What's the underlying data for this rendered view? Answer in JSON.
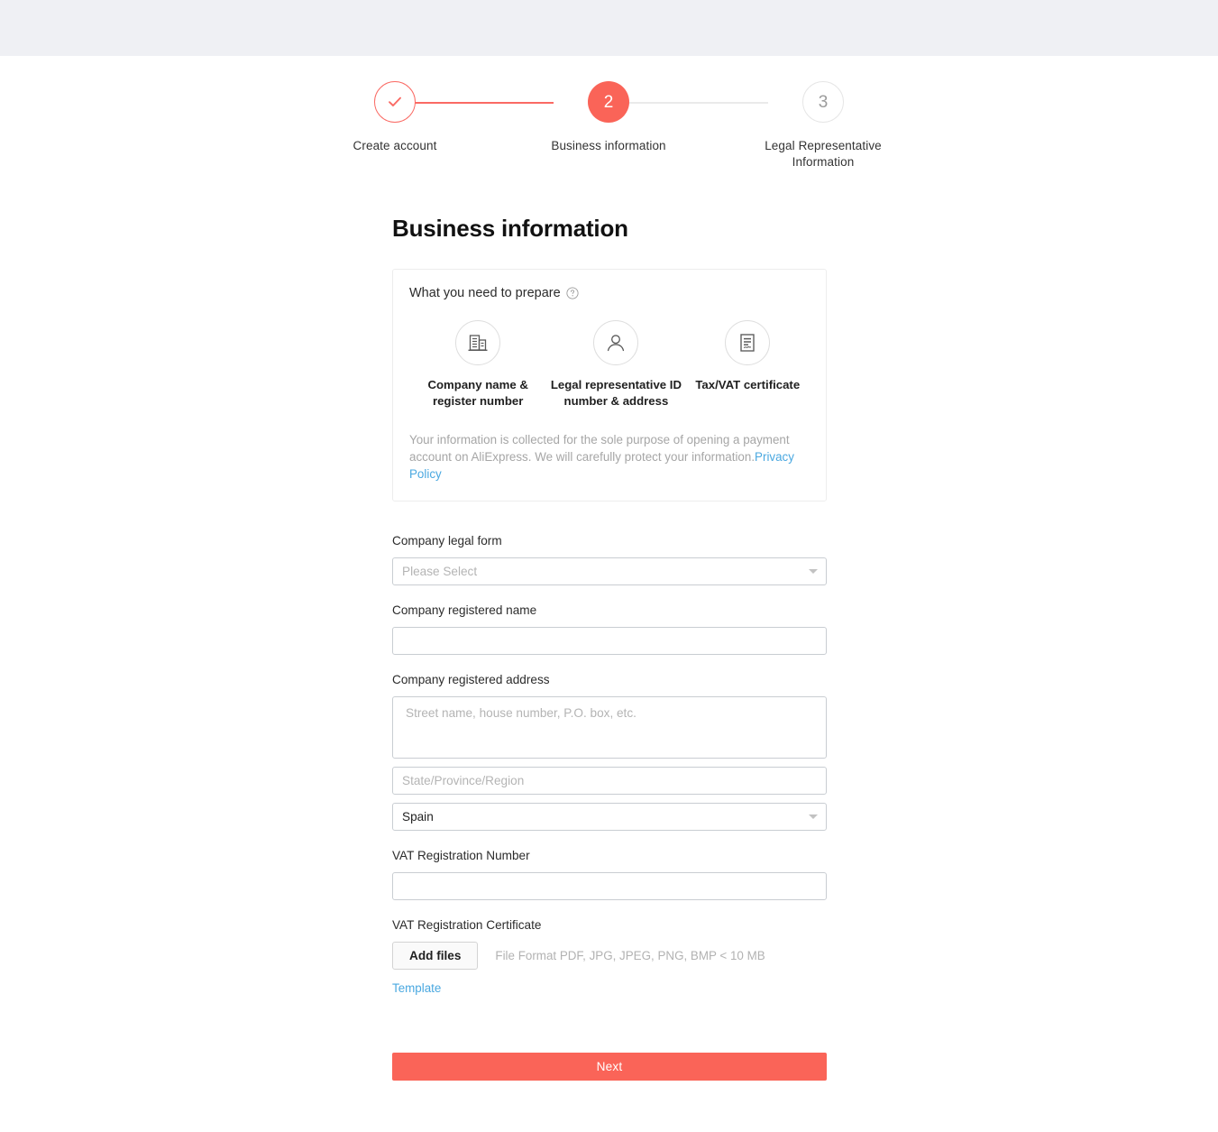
{
  "stepper": {
    "steps": [
      {
        "marker": "check-icon",
        "number": "",
        "label": "Create account",
        "state": "done"
      },
      {
        "marker": "2",
        "number": "2",
        "label": "Business information",
        "state": "active"
      },
      {
        "marker": "3",
        "number": "3",
        "label": "Legal Representative Information",
        "state": "todo"
      }
    ]
  },
  "main": {
    "title": "Business information"
  },
  "prepare": {
    "heading": "What you need to prepare",
    "help_icon": "question-circle-icon",
    "items": [
      {
        "icon": "building-icon",
        "label": "Company name & register number"
      },
      {
        "icon": "person-icon",
        "label": "Legal representative ID number & address"
      },
      {
        "icon": "document-icon",
        "label": "Tax/VAT certificate"
      }
    ],
    "privacy_text": "Your information is collected for the sole purpose of opening a payment account on AliExpress. We will carefully protect your information.",
    "privacy_link": "Privacy Policy"
  },
  "form": {
    "legal_form": {
      "label": "Company legal form",
      "value": "",
      "placeholder": "Please Select"
    },
    "registered_name": {
      "label": "Company registered name",
      "value": "",
      "placeholder": ""
    },
    "registered_address": {
      "label": "Company registered address",
      "street_placeholder": "Street name, house number, P.O. box, etc.",
      "street_value": "",
      "state_placeholder": "State/Province/Region",
      "state_value": "",
      "country_value": "Spain"
    },
    "vat_number": {
      "label": "VAT Registration Number",
      "value": "",
      "placeholder": ""
    },
    "vat_certificate": {
      "label": "VAT Registration Certificate",
      "add_files_label": "Add files",
      "file_hint": "File Format PDF, JPG, JPEG, PNG, BMP < 10 MB",
      "template_link": "Template"
    },
    "submit_label": "Next"
  },
  "colors": {
    "accent": "#fa6458",
    "link": "#4aa8e0",
    "topbar": "#eff0f4",
    "muted": "#b4b4b4"
  }
}
